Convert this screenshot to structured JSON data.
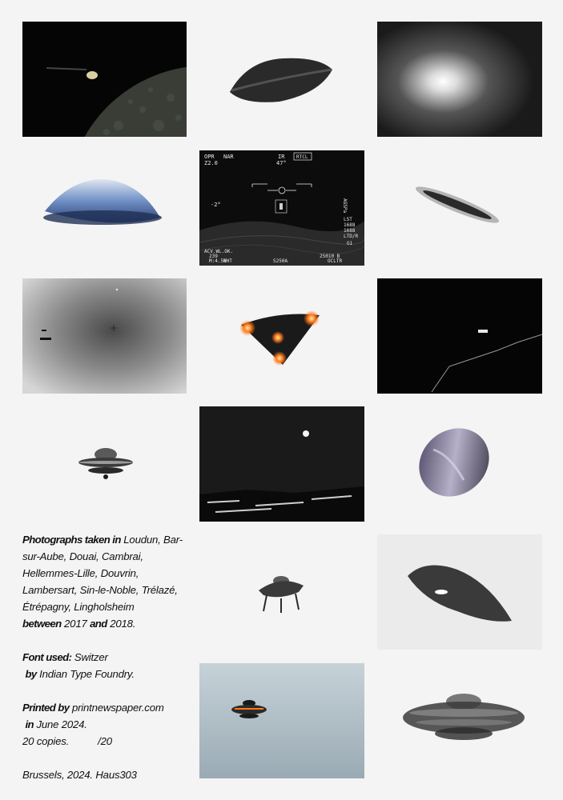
{
  "photos": [
    {
      "id": "moon-craft",
      "subject": "craft above lunar surface"
    },
    {
      "id": "saucer-dark",
      "subject": "dark disc saucer"
    },
    {
      "id": "glow",
      "subject": "bright glowing light"
    },
    {
      "id": "blue-dome",
      "subject": "bluish domed disc"
    },
    {
      "id": "fur-cockpit",
      "subject": "infrared targeting display"
    },
    {
      "id": "cigar",
      "subject": "cigar shaped object"
    },
    {
      "id": "gray-sky",
      "subject": "grey sky with crosshair"
    },
    {
      "id": "triangle",
      "subject": "triangular craft with three lights"
    },
    {
      "id": "night-trail",
      "subject": "night object with trail"
    },
    {
      "id": "small-saucer",
      "subject": "small saucer with dome"
    },
    {
      "id": "night-moon",
      "subject": "night landscape with light"
    },
    {
      "id": "violet-disc",
      "subject": "tilted violet disc"
    },
    {
      "id": "domed-saucer",
      "subject": "domed saucer with legs"
    },
    {
      "id": "grainy-blob",
      "subject": "grainy dark object"
    },
    {
      "id": "sky-saucer",
      "subject": "saucer against pale sky"
    },
    {
      "id": "blurry-saucer",
      "subject": "blurred ringed saucer"
    }
  ],
  "hud": {
    "top_left": "OPR",
    "zoom": "Z2.0",
    "nar": "NAR",
    "ir": "IR",
    "rtcl": "RTCL",
    "heading": "47°",
    "left_mark": "-2°",
    "right_vert": "AGSPa",
    "lst": "LST",
    "v1": "1688",
    "v2": "1688",
    "ltd": "LTD/R",
    "g1": "G1",
    "bottom_left": "ACV.WL.OK.",
    "alt": "239",
    "time": "M:4.58",
    "wht": "WHT",
    "mid": "S250A",
    "range": "25010 B",
    "oclt": "OCLTR"
  },
  "colophon": {
    "photos_label": "Photographs taken in",
    "places": "Loudun, Bar-sur-Aube, Douai, Cambrai, Hellemmes-Lille, Douvrin, Lambersart, Sin-le-Noble, Trélazé, Étrépagny, Lingholsheim",
    "between_label": "between",
    "year_from": "2017",
    "and_label": "and",
    "year_to": "2018.",
    "font_label": "Font used:",
    "font_name": "Switzer",
    "by_label": "by",
    "foundry": "Indian Type Foundry.",
    "printed_label": "Printed by",
    "printer": "printnewspaper.com",
    "in_label": "in",
    "date": "June 2024.",
    "copies": "20 copies.",
    "copy_of": "/20",
    "footer": "Brussels, 2024. Haus303"
  },
  "colors": {
    "background": "#f4f4f4",
    "text": "#111111",
    "orange_light": "#ff7a1a"
  }
}
